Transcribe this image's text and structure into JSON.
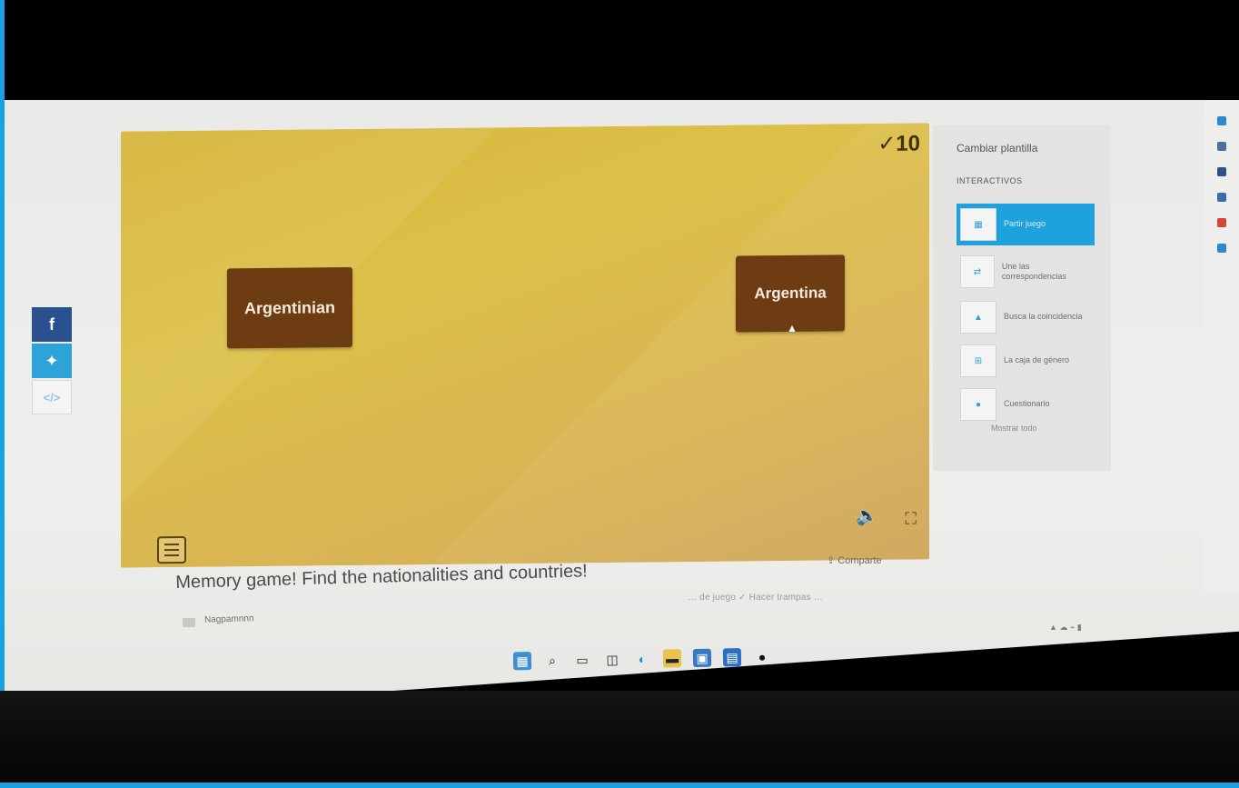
{
  "social": {
    "facebook_glyph": "f",
    "twitter_glyph": "✦",
    "embed_glyph": "</>"
  },
  "game": {
    "score": "✓10",
    "cards": [
      {
        "text": "Argentinian"
      },
      {
        "text": "Argentina"
      }
    ]
  },
  "activity": {
    "title": "Memory game! Find the nationalities and countries!",
    "author": "Nagpamnnn",
    "share_label": "Comparte",
    "meta": "… de juego  ✓ Hacer trampas  …"
  },
  "panel": {
    "header": "Cambiar plantilla",
    "subheader": "INTERACTIVOS",
    "templates": [
      {
        "label": "Partir juego",
        "icon": "grid-icon",
        "active": true
      },
      {
        "label": "Une las correspondencias",
        "icon": "match-icon",
        "active": false
      },
      {
        "label": "Busca la coincidencia",
        "icon": "find-match-icon",
        "active": false
      },
      {
        "label": "La caja de género",
        "icon": "group-sort-icon",
        "active": false
      },
      {
        "label": "Cuestionario",
        "icon": "quiz-icon",
        "active": false
      }
    ],
    "more_label": "Mostrar todo"
  },
  "taskbar": {
    "icons": [
      "windows-icon",
      "search-icon",
      "taskview-icon",
      "widgets-icon",
      "edge-icon",
      "explorer-icon",
      "store-icon",
      "mail-icon",
      "app-icon"
    ]
  },
  "colors": {
    "facebook": "#29518f",
    "twitter": "#2ea3d8",
    "card": "#6e3c12",
    "game_bg": "#dcc04a",
    "active_template": "#1fa1dd"
  }
}
